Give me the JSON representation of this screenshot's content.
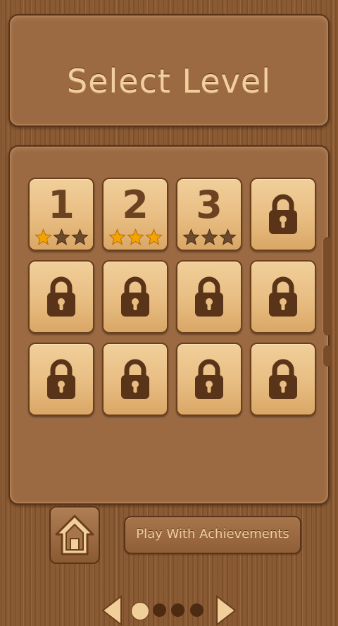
{
  "header": {
    "title": "Select Level"
  },
  "levels": [
    {
      "label": "1",
      "locked": false,
      "stars": 1
    },
    {
      "label": "2",
      "locked": false,
      "stars": 3
    },
    {
      "label": "3",
      "locked": false,
      "stars": 0
    },
    {
      "label": "",
      "locked": true
    },
    {
      "label": "",
      "locked": true
    },
    {
      "label": "",
      "locked": true
    },
    {
      "label": "",
      "locked": true
    },
    {
      "label": "",
      "locked": true
    },
    {
      "label": "",
      "locked": true
    },
    {
      "label": "",
      "locked": true
    },
    {
      "label": "",
      "locked": true
    },
    {
      "label": "",
      "locked": true
    }
  ],
  "max_stars": 3,
  "pager": {
    "pages": 4,
    "current": 1,
    "prev_icon": "triangle-left-icon",
    "next_icon": "triangle-right-icon"
  },
  "footer": {
    "home_icon": "home-icon",
    "achievements_label": "Play With Achievements"
  },
  "colors": {
    "star_filled": "#f5a300",
    "star_empty": "#6b4a2e",
    "tile": "#e8bd82",
    "wood": "#8a5a33",
    "icon_dark": "#5a3418"
  }
}
